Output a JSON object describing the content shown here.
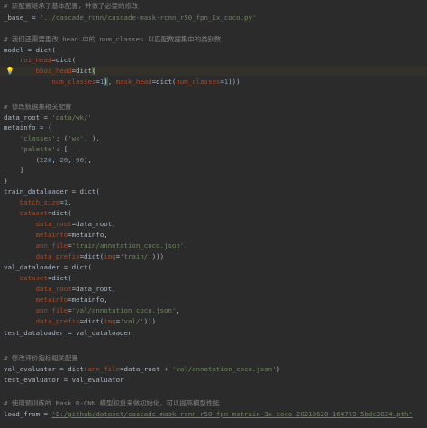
{
  "editor": {
    "lines": [
      {
        "tokens": [
          {
            "t": "# 新配置继承了基本配置，并做了必要的修改",
            "c": "comment"
          }
        ]
      },
      {
        "tokens": [
          {
            "t": "_base_",
            "c": "var"
          },
          {
            "t": " = ",
            "c": "var"
          },
          {
            "t": "'../cascade_rcnn/cascade-mask-rcnn_r50_fpn_1x_coco.py'",
            "c": "str"
          }
        ]
      },
      {
        "tokens": []
      },
      {
        "tokens": [
          {
            "t": "# 我们还需要更改 head 中的 num_classes 以匹配数据集中的类别数",
            "c": "comment"
          }
        ]
      },
      {
        "tokens": [
          {
            "t": "model = ",
            "c": "var"
          },
          {
            "t": "dict",
            "c": "var"
          },
          {
            "t": "(",
            "c": "paren"
          }
        ]
      },
      {
        "tokens": [
          {
            "t": "    ",
            "c": "var"
          },
          {
            "t": "roi_head",
            "c": "param"
          },
          {
            "t": "=dict(",
            "c": "var"
          }
        ]
      },
      {
        "highlight": true,
        "bulb": true,
        "tokens": [
          {
            "t": "        ",
            "c": "var"
          },
          {
            "t": "bbox_head",
            "c": "param"
          },
          {
            "t": "=dict",
            "c": "var"
          },
          {
            "t": "(",
            "c": "match"
          }
        ]
      },
      {
        "tokens": [
          {
            "t": "            ",
            "c": "var"
          },
          {
            "t": "num_classes",
            "c": "param"
          },
          {
            "t": "=",
            "c": "var"
          },
          {
            "t": "1",
            "c": "num"
          },
          {
            "t": ")",
            "c": "match"
          },
          {
            "t": ", ",
            "c": "var"
          },
          {
            "t": "mask_head",
            "c": "param"
          },
          {
            "t": "=dict(",
            "c": "var"
          },
          {
            "t": "num_classes",
            "c": "param"
          },
          {
            "t": "=",
            "c": "var"
          },
          {
            "t": "1",
            "c": "num"
          },
          {
            "t": ")))",
            "c": "var"
          }
        ]
      },
      {
        "tokens": []
      },
      {
        "tokens": []
      },
      {
        "tokens": [
          {
            "t": "# 修改数据集相关配置",
            "c": "comment"
          }
        ]
      },
      {
        "tokens": [
          {
            "t": "data_root = ",
            "c": "var"
          },
          {
            "t": "'data/wk/'",
            "c": "str"
          }
        ]
      },
      {
        "tokens": [
          {
            "t": "metainfo",
            "c": "var"
          },
          {
            "t": " = {",
            "c": "var"
          }
        ]
      },
      {
        "tokens": [
          {
            "t": "    ",
            "c": "var"
          },
          {
            "t": "'classes'",
            "c": "str"
          },
          {
            "t": ": (",
            "c": "var"
          },
          {
            "t": "'wk'",
            "c": "str"
          },
          {
            "t": ", ),",
            "c": "var"
          }
        ]
      },
      {
        "tokens": [
          {
            "t": "    ",
            "c": "var"
          },
          {
            "t": "'palette'",
            "c": "str"
          },
          {
            "t": ": [",
            "c": "var"
          }
        ]
      },
      {
        "tokens": [
          {
            "t": "        (",
            "c": "var"
          },
          {
            "t": "220",
            "c": "num"
          },
          {
            "t": ", ",
            "c": "var"
          },
          {
            "t": "20",
            "c": "num"
          },
          {
            "t": ", ",
            "c": "var"
          },
          {
            "t": "60",
            "c": "num"
          },
          {
            "t": "),",
            "c": "var"
          }
        ]
      },
      {
        "tokens": [
          {
            "t": "    ]",
            "c": "var"
          }
        ]
      },
      {
        "tokens": [
          {
            "t": "}",
            "c": "var"
          }
        ]
      },
      {
        "tokens": [
          {
            "t": "train_dataloader = dict(",
            "c": "var"
          }
        ]
      },
      {
        "tokens": [
          {
            "t": "    ",
            "c": "var"
          },
          {
            "t": "batch_size",
            "c": "param"
          },
          {
            "t": "=",
            "c": "var"
          },
          {
            "t": "1",
            "c": "num"
          },
          {
            "t": ",",
            "c": "var"
          }
        ]
      },
      {
        "tokens": [
          {
            "t": "    ",
            "c": "var"
          },
          {
            "t": "dataset",
            "c": "param"
          },
          {
            "t": "=dict(",
            "c": "var"
          }
        ]
      },
      {
        "tokens": [
          {
            "t": "        ",
            "c": "var"
          },
          {
            "t": "data_root",
            "c": "param"
          },
          {
            "t": "=data_root,",
            "c": "var"
          }
        ]
      },
      {
        "tokens": [
          {
            "t": "        ",
            "c": "var"
          },
          {
            "t": "metainfo",
            "c": "param"
          },
          {
            "t": "=metainfo,",
            "c": "var"
          }
        ]
      },
      {
        "tokens": [
          {
            "t": "        ",
            "c": "var"
          },
          {
            "t": "ann_file",
            "c": "param"
          },
          {
            "t": "=",
            "c": "var"
          },
          {
            "t": "'train/annotation_coco.json'",
            "c": "str"
          },
          {
            "t": ",",
            "c": "var"
          }
        ]
      },
      {
        "tokens": [
          {
            "t": "        ",
            "c": "var"
          },
          {
            "t": "data_prefix",
            "c": "param"
          },
          {
            "t": "=dict(",
            "c": "var"
          },
          {
            "t": "img",
            "c": "param"
          },
          {
            "t": "=",
            "c": "var"
          },
          {
            "t": "'train/'",
            "c": "str"
          },
          {
            "t": ")))",
            "c": "var"
          }
        ]
      },
      {
        "tokens": [
          {
            "t": "val_dataloader = dict(",
            "c": "var"
          }
        ]
      },
      {
        "tokens": [
          {
            "t": "    ",
            "c": "var"
          },
          {
            "t": "dataset",
            "c": "param"
          },
          {
            "t": "=dict(",
            "c": "var"
          }
        ]
      },
      {
        "tokens": [
          {
            "t": "        ",
            "c": "var"
          },
          {
            "t": "data_root",
            "c": "param"
          },
          {
            "t": "=data_root,",
            "c": "var"
          }
        ]
      },
      {
        "tokens": [
          {
            "t": "        ",
            "c": "var"
          },
          {
            "t": "metainfo",
            "c": "param"
          },
          {
            "t": "=metainfo,",
            "c": "var"
          }
        ]
      },
      {
        "tokens": [
          {
            "t": "        ",
            "c": "var"
          },
          {
            "t": "ann_file",
            "c": "param"
          },
          {
            "t": "=",
            "c": "var"
          },
          {
            "t": "'val/annotation_coco.json'",
            "c": "str"
          },
          {
            "t": ",",
            "c": "var"
          }
        ]
      },
      {
        "tokens": [
          {
            "t": "        ",
            "c": "var"
          },
          {
            "t": "data_prefix",
            "c": "param"
          },
          {
            "t": "=dict(",
            "c": "var"
          },
          {
            "t": "img",
            "c": "param"
          },
          {
            "t": "=",
            "c": "var"
          },
          {
            "t": "'val/'",
            "c": "str"
          },
          {
            "t": ")))",
            "c": "var"
          }
        ]
      },
      {
        "tokens": [
          {
            "t": "test_dataloader = val_dataloader",
            "c": "var"
          }
        ]
      },
      {
        "tokens": []
      },
      {
        "tokens": []
      },
      {
        "tokens": [
          {
            "t": "# 修改评价指标相关配置",
            "c": "comment"
          }
        ]
      },
      {
        "tokens": [
          {
            "t": "val_evaluator = dict(",
            "c": "var"
          },
          {
            "t": "ann_file",
            "c": "param"
          },
          {
            "t": "=data_root + ",
            "c": "var"
          },
          {
            "t": "'val/annotation_coco.json'",
            "c": "str"
          },
          {
            "t": ")",
            "c": "var"
          }
        ]
      },
      {
        "tokens": [
          {
            "t": "test_evaluator = val_evaluator",
            "c": "var"
          }
        ]
      },
      {
        "tokens": []
      },
      {
        "tokens": []
      },
      {
        "tokens": [
          {
            "t": "# 使用预训练的 Mask R-CNN 模型权重来做初始化，可以提高模型性能",
            "c": "comment"
          }
        ]
      },
      {
        "tokens": [
          {
            "t": "load_from = ",
            "c": "var"
          },
          {
            "t": "'E:/github/dataset/cascade_mask_rcnn_r50_fpn_mstrain_3x_coco_20210628_164719-5bdc3824.pth'",
            "c": "link"
          }
        ]
      }
    ]
  },
  "colors": {
    "background": "#2b2b2b",
    "comment": "#808080",
    "string": "#6a8759",
    "number": "#6897bb",
    "param": "#aa4926",
    "text": "#a9b7c6",
    "bracket_match": "#ffef28",
    "current_line": "#32302a"
  },
  "icons": {
    "intention_bulb": "lightbulb-icon"
  }
}
